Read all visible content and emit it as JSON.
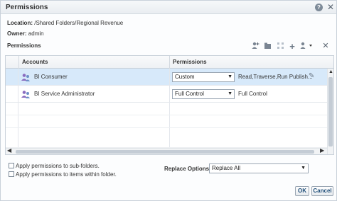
{
  "window": {
    "title": "Permissions"
  },
  "info": {
    "location_label": "Location:",
    "location_value": "/Shared Folders/Regional Revenue",
    "owner_label": "Owner:",
    "owner_value": "admin"
  },
  "section": {
    "title": "Permissions"
  },
  "toolbar": {
    "icons": [
      "add-user-icon",
      "add-group-icon",
      "expand-icon",
      "add-icon",
      "settings-dropdown-icon",
      "delete-icon"
    ]
  },
  "table": {
    "columns": [
      "Accounts",
      "Permissions"
    ],
    "rows": [
      {
        "account": "BI Consumer",
        "permission": "Custom",
        "detail": "Read,Traverse,Run Publish..."
      },
      {
        "account": "BI Service Administrator",
        "permission": "Full Control",
        "detail": "Full Control"
      }
    ]
  },
  "options": {
    "sub_folders": "Apply permissions to sub-folders.",
    "items_within": "Apply permissions to items within folder.",
    "replace_label": "Replace Options",
    "replace_value": "Replace All"
  },
  "buttons": {
    "ok": "OK",
    "cancel": "Cancel"
  },
  "colors": {
    "selected_row": "#d7e9fa",
    "button_text": "#1f4e79"
  }
}
